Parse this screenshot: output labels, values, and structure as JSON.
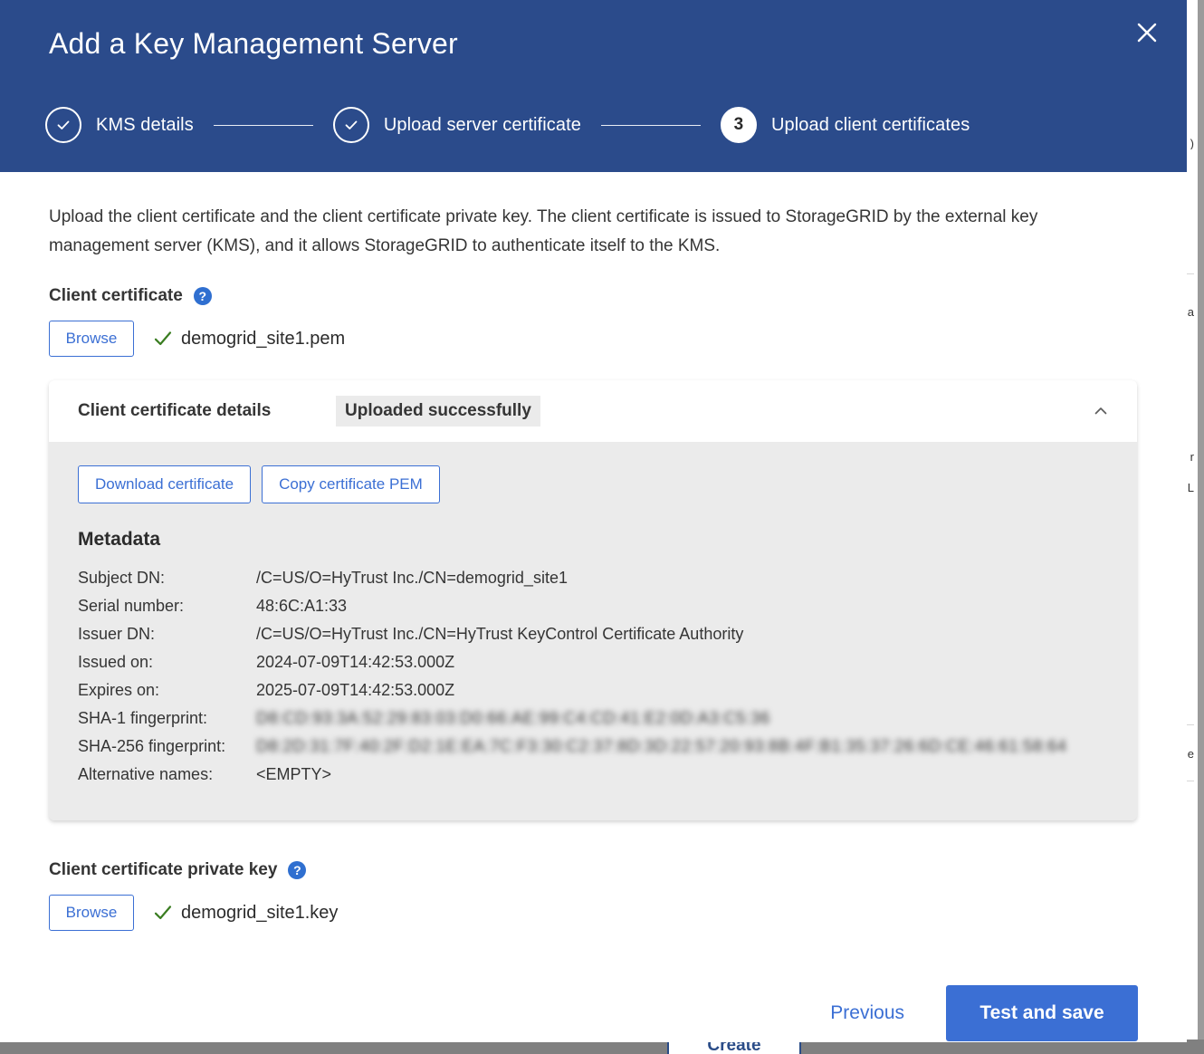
{
  "modal": {
    "title": "Add a Key Management Server",
    "close_label": "×",
    "stepper": [
      {
        "label": "KMS details",
        "state": "done",
        "marker": "✓"
      },
      {
        "label": "Upload server certificate",
        "state": "done",
        "marker": "✓"
      },
      {
        "label": "Upload client certificates",
        "state": "current",
        "marker": "3"
      }
    ],
    "intro": "Upload the client certificate and the client certificate private key. The client certificate is issued to StorageGRID by the external key management server (KMS), and it allows StorageGRID to authenticate itself to the KMS."
  },
  "client_certificate": {
    "label": "Client certificate",
    "help": "?",
    "browse_label": "Browse",
    "file_name": "demogrid_site1.pem"
  },
  "details_panel": {
    "title": "Client certificate details",
    "status_badge": "Uploaded successfully",
    "collapse_state": "expanded",
    "actions": {
      "download_label": "Download certificate",
      "copy_label": "Copy certificate PEM"
    },
    "metadata_title": "Metadata",
    "metadata": [
      {
        "key": "Subject DN:",
        "value": "/C=US/O=HyTrust Inc./CN=demogrid_site1",
        "redacted": false
      },
      {
        "key": "Serial number:",
        "value": "48:6C:A1:33",
        "redacted": false
      },
      {
        "key": "Issuer DN:",
        "value": "/C=US/O=HyTrust Inc./CN=HyTrust KeyControl Certificate Authority",
        "redacted": false
      },
      {
        "key": "Issued on:",
        "value": "2024-07-09T14:42:53.000Z",
        "redacted": false
      },
      {
        "key": "Expires on:",
        "value": "2025-07-09T14:42:53.000Z",
        "redacted": false
      },
      {
        "key": "SHA-1 fingerprint:",
        "value": "D8:CD:93:3A:52:29:83:03:D0:66:AE:99:C4:CD:41:E2:0D:A3:C5:36",
        "redacted": true
      },
      {
        "key": "SHA-256 fingerprint:",
        "value": "D8:2D:31:7F:40:2F:D2:1E:EA:7C:F3:30:C2:37:8D:3D:22:57:20:93:8B:4F:B1:35:37:26:6D:CE:46:61:58:64",
        "redacted": true
      },
      {
        "key": "Alternative names:",
        "value": "<EMPTY>",
        "redacted": false
      }
    ]
  },
  "private_key": {
    "label": "Client certificate private key",
    "help": "?",
    "browse_label": "Browse",
    "file_name": "demogrid_site1.key"
  },
  "footer": {
    "previous_label": "Previous",
    "test_save_label": "Test and save"
  },
  "background": {
    "create_label": "Create"
  },
  "colors": {
    "header_blue": "#2b4b8b",
    "accent_blue": "#3b6fd4",
    "help_blue": "#2f6fd0",
    "check_green": "#3a7d21",
    "panel_gray": "#ebebeb",
    "text": "#353535"
  }
}
